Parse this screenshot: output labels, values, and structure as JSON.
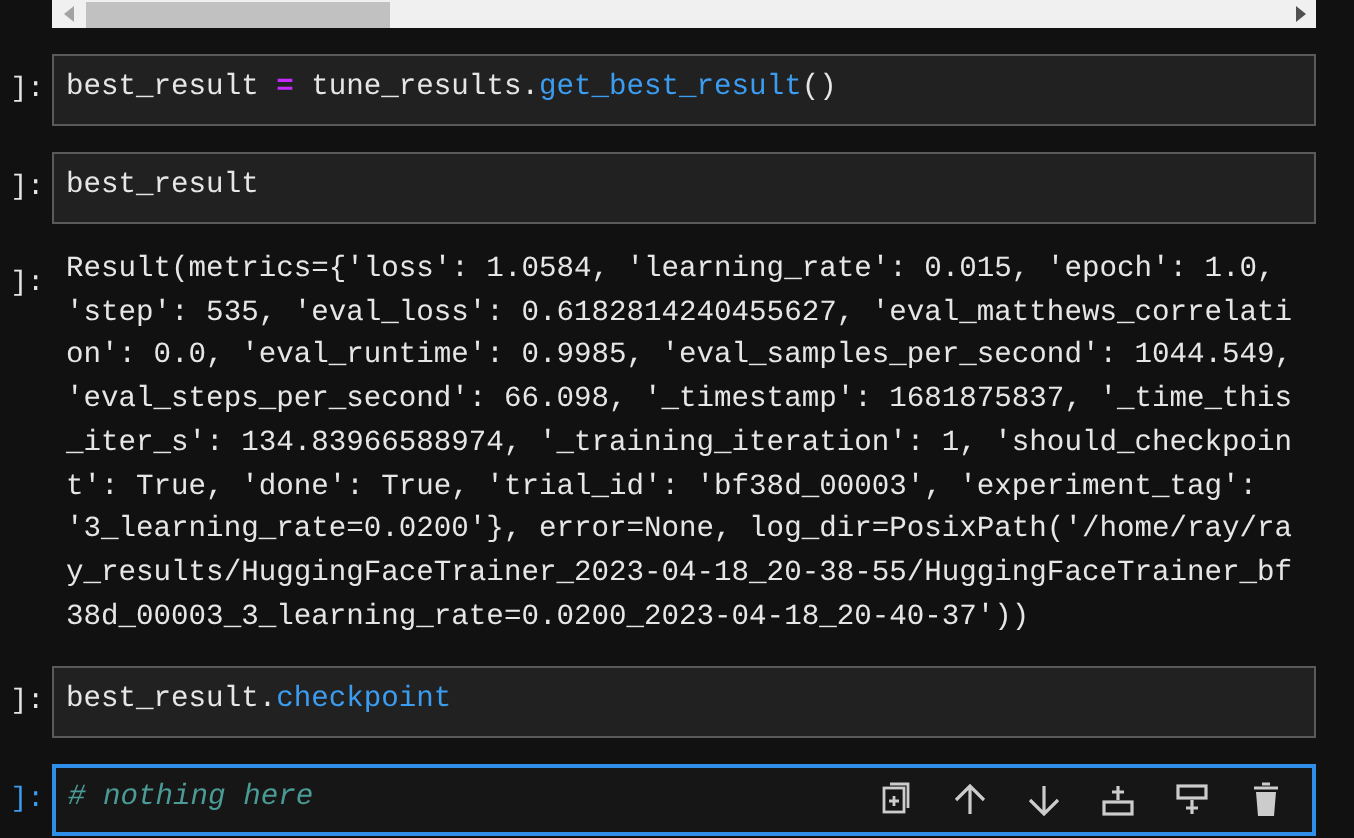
{
  "cells": [
    {
      "kind": "code",
      "prompt": "]:",
      "selected": false,
      "tokens": [
        {
          "kind": "plain",
          "text": "best_result "
        },
        {
          "kind": "operator",
          "text": "="
        },
        {
          "kind": "plain",
          "text": " tune_results."
        },
        {
          "kind": "function",
          "text": "get_best_result"
        },
        {
          "kind": "plain",
          "text": "()"
        }
      ]
    },
    {
      "kind": "code",
      "prompt": "]:",
      "selected": false,
      "tokens": [
        {
          "kind": "plain",
          "text": "best_result"
        }
      ]
    },
    {
      "kind": "output",
      "prompt": "]:",
      "text": "Result(metrics={'loss': 1.0584, 'learning_rate': 0.015, 'epoch': 1.0, 'step': 535, 'eval_loss': 0.6182814240455627, 'eval_matthews_correlation': 0.0, 'eval_runtime': 0.9985, 'eval_samples_per_second': 1044.549, 'eval_steps_per_second': 66.098, '_timestamp': 1681875837, '_time_this_iter_s': 134.83966588974, '_training_iteration': 1, 'should_checkpoint': True, 'done': True, 'trial_id': 'bf38d_00003', 'experiment_tag': '3_learning_rate=0.0200'}, error=None, log_dir=PosixPath('/home/ray/ray_results/HuggingFaceTrainer_2023-04-18_20-38-55/HuggingFaceTrainer_bf38d_00003_3_learning_rate=0.0200_2023-04-18_20-40-37'))"
    },
    {
      "kind": "code",
      "prompt": "]:",
      "selected": false,
      "tokens": [
        {
          "kind": "plain",
          "text": "best_result."
        },
        {
          "kind": "function",
          "text": "checkpoint"
        }
      ]
    },
    {
      "kind": "code",
      "prompt": "]:",
      "selected": true,
      "tokens": [
        {
          "kind": "comment",
          "text": "# nothing here"
        }
      ]
    }
  ]
}
